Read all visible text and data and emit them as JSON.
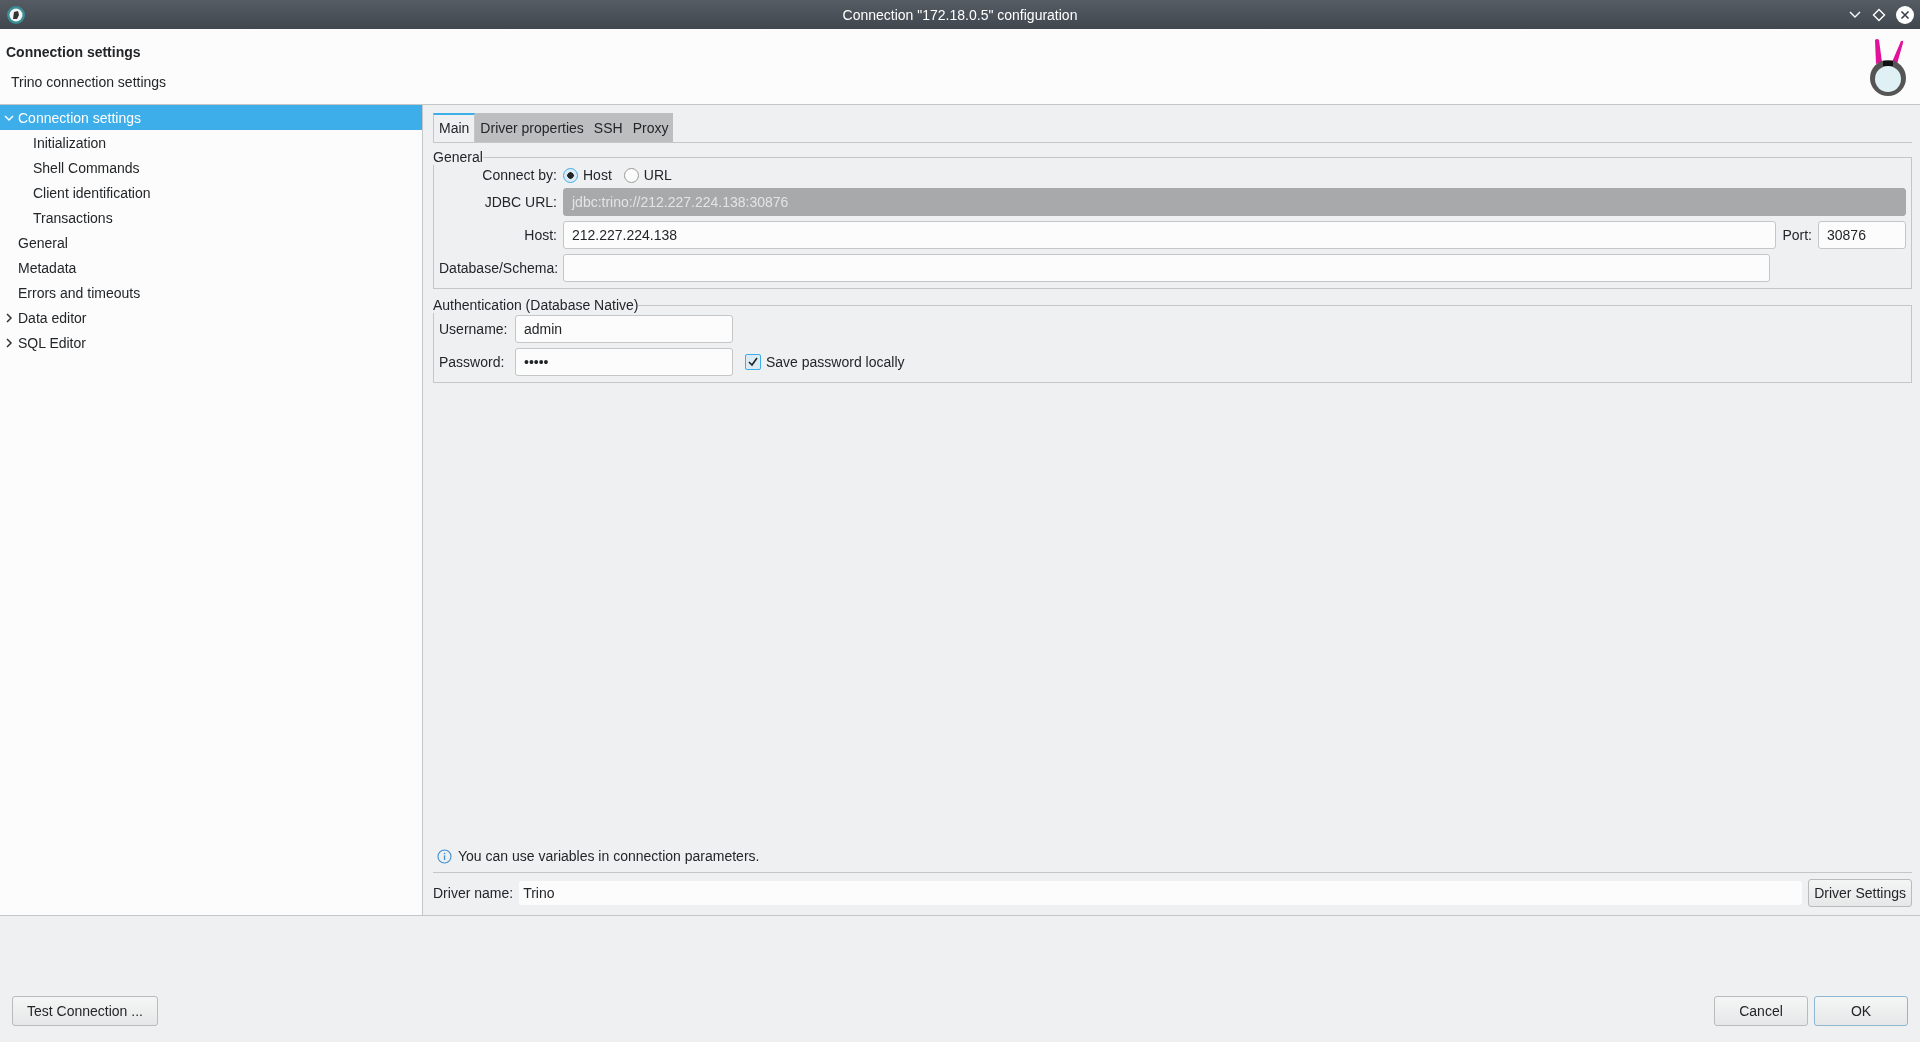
{
  "window": {
    "title": "Connection \"172.18.0.5\" configuration"
  },
  "header": {
    "title": "Connection settings",
    "subtitle": "Trino connection settings"
  },
  "sidebar": {
    "items": [
      {
        "label": "Connection settings",
        "selected": true,
        "expanded": true,
        "children": [
          {
            "label": "Initialization",
            "selected": false
          },
          {
            "label": "Shell Commands",
            "selected": false
          },
          {
            "label": "Client identification",
            "selected": false
          },
          {
            "label": "Transactions",
            "selected": false
          }
        ]
      },
      {
        "label": "General",
        "selected": false
      },
      {
        "label": "Metadata",
        "selected": false
      },
      {
        "label": "Errors and timeouts",
        "selected": false
      },
      {
        "label": "Data editor",
        "selected": false,
        "expanded": false
      },
      {
        "label": "SQL Editor",
        "selected": false,
        "expanded": false
      }
    ]
  },
  "tabs": [
    {
      "label": "Main",
      "selected": true
    },
    {
      "label": "Driver properties",
      "selected": false
    },
    {
      "label": "SSH",
      "selected": false
    },
    {
      "label": "Proxy",
      "selected": false
    }
  ],
  "general": {
    "title": "General",
    "connect_by_label": "Connect by:",
    "connect_by": [
      {
        "label": "Host",
        "selected": true
      },
      {
        "label": "URL",
        "selected": false
      }
    ],
    "jdbc_url": {
      "label": "JDBC URL:",
      "value": "jdbc:trino://212.227.224.138:30876",
      "disabled": true
    },
    "host": {
      "label": "Host:",
      "value": "212.227.224.138"
    },
    "port": {
      "label": "Port:",
      "value": "30876"
    },
    "database": {
      "label": "Database/Schema:"
    }
  },
  "authentication": {
    "title": "Authentication (Database Native)",
    "username": {
      "label": "Username:",
      "value": "admin"
    },
    "password": {
      "label": "Password:",
      "value": "•••••"
    },
    "save_password": {
      "label": "Save password locally",
      "checked": true
    }
  },
  "info": "You can use variables in connection parameters.",
  "driver": {
    "label": "Driver name:",
    "value": "Trino",
    "button": "Driver Settings"
  },
  "buttons": {
    "test": "Test Connection ...",
    "cancel": "Cancel",
    "ok": "OK"
  }
}
